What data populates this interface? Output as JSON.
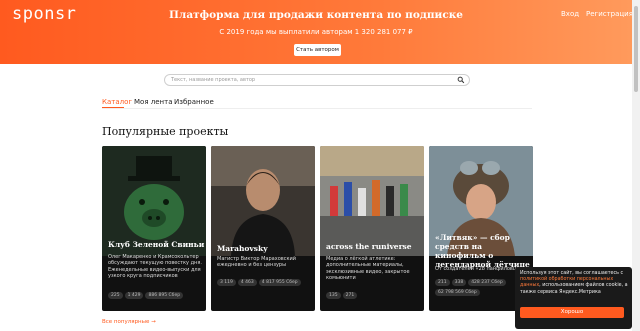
{
  "header": {
    "logo": "sponsr",
    "login": "Вход",
    "register": "Регистрация",
    "title": "Платформа для продажи контента по подписке",
    "subtitle": "С 2019 года мы выплатили авторам 1 320 281 077 ₽",
    "become_author": "Стать автором"
  },
  "search": {
    "placeholder": "Текст, название проекта, автор"
  },
  "tabs": [
    {
      "label": "Каталог",
      "active": true
    },
    {
      "label": "Моя лента",
      "active": false
    },
    {
      "label": "Избранное",
      "active": false
    }
  ],
  "section_title": "Популярные проекты",
  "cards": [
    {
      "title": "Клуб Зеленой Свиньи",
      "desc": "Олег Макаренко и Крамсокольтер обсуждают текущую повестку дня. Еженедельные видео-выпуски для узкого круга подписчиков",
      "stats": [
        "225",
        "1 429",
        "886 895 Сбер"
      ]
    },
    {
      "title": "Marahovsky",
      "desc": "Магистр Виктор Мараховский ежедневно и без цензуры",
      "stats": [
        "3 119",
        "4 463",
        "4 817 955 Сбер"
      ]
    },
    {
      "title": "across the runiverse",
      "desc": "Медиа о лёгкой атлетике: дополнительные материалы, эксклюзивные видео, закрытое комьюнити",
      "stats": [
        "135",
        "271"
      ]
    },
    {
      "title": "«Литвяк» — сбор средств на кинофильм о легендарной лётчице",
      "desc": "От создателей «28 панфиловцев»",
      "stats": [
        "211",
        "338",
        "428 237 Сбер",
        "62 798 569 Сбер"
      ]
    }
  ],
  "all_popular": "Все популярные →",
  "cookie": {
    "text_before": "Используя этот сайт, вы соглашаетесь с ",
    "link": "политикой обработки персональных данных",
    "text_after": ", использованием файлов cookie, а также сервиса Яндекс.Метрика",
    "button": "Хорошо"
  },
  "colors": {
    "accent": "#ff5a1f"
  }
}
